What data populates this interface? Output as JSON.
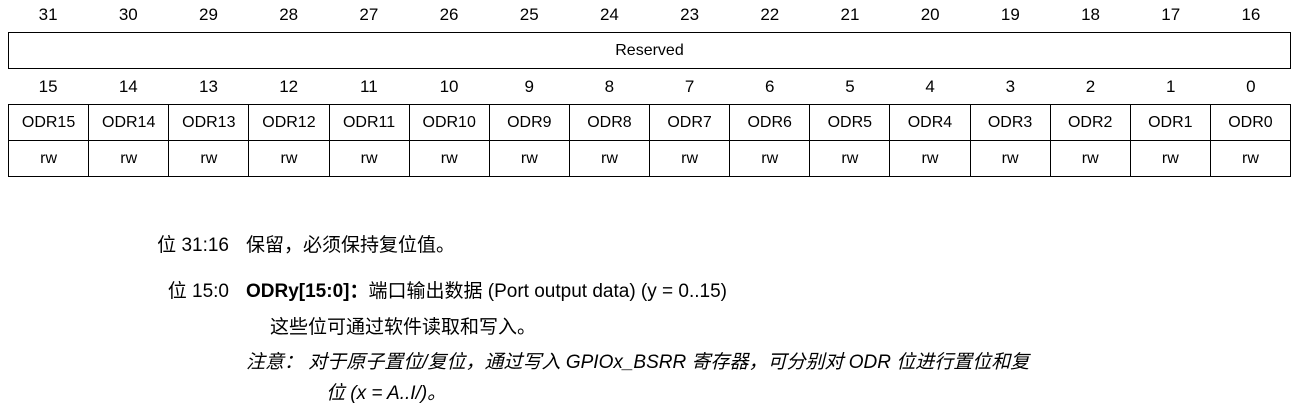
{
  "register": {
    "upper_bits": [
      "31",
      "30",
      "29",
      "28",
      "27",
      "26",
      "25",
      "24",
      "23",
      "22",
      "21",
      "20",
      "19",
      "18",
      "17",
      "16"
    ],
    "reserved_label": "Reserved",
    "lower_bits": [
      "15",
      "14",
      "13",
      "12",
      "11",
      "10",
      "9",
      "8",
      "7",
      "6",
      "5",
      "4",
      "3",
      "2",
      "1",
      "0"
    ],
    "fields": [
      "ODR15",
      "ODR14",
      "ODR13",
      "ODR12",
      "ODR11",
      "ODR10",
      "ODR9",
      "ODR8",
      "ODR7",
      "ODR6",
      "ODR5",
      "ODR4",
      "ODR3",
      "ODR2",
      "ODR1",
      "ODR0"
    ],
    "access": [
      "rw",
      "rw",
      "rw",
      "rw",
      "rw",
      "rw",
      "rw",
      "rw",
      "rw",
      "rw",
      "rw",
      "rw",
      "rw",
      "rw",
      "rw",
      "rw"
    ]
  },
  "descriptions": {
    "bits_31_16": {
      "label": "位 31:16",
      "text": "保留，必须保持复位值。"
    },
    "bits_15_0": {
      "label": "位 15:0",
      "field_name": "ODRy[15:0]",
      "field_colon": "：",
      "field_desc": "端口输出数据 (Port output data) (y = 0..15)",
      "detail": "这些位可通过软件读取和写入。",
      "note_line1": "注意：  对于原子置位/复位，通过写入 GPIOx_BSRR 寄存器，可分别对 ODR 位进行置位和复",
      "note_line2": "位 (x = A..I/)。"
    }
  }
}
